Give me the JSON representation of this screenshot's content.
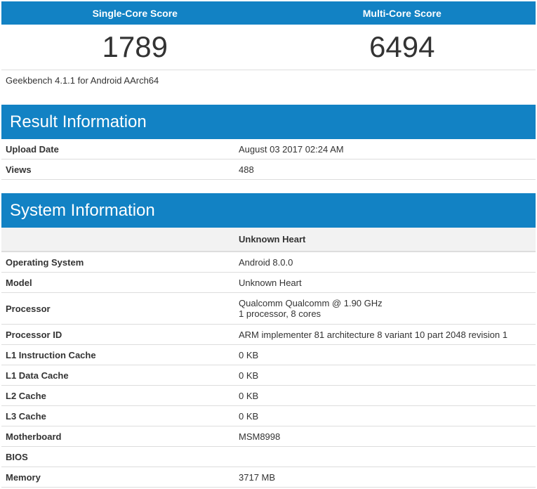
{
  "scores": {
    "single_core_label": "Single-Core Score",
    "multi_core_label": "Multi-Core Score",
    "single_core_value": "1789",
    "multi_core_value": "6494"
  },
  "benchmark_version": "Geekbench 4.1.1 for Android AArch64",
  "result_information": {
    "title": "Result Information",
    "rows": [
      {
        "label": "Upload Date",
        "value": "August 03 2017 02:24 AM"
      },
      {
        "label": "Views",
        "value": "488"
      }
    ]
  },
  "system_information": {
    "title": "System Information",
    "device_name": "Unknown Heart",
    "rows": [
      {
        "label": "Operating System",
        "value": "Android 8.0.0"
      },
      {
        "label": "Model",
        "value": "Unknown Heart"
      },
      {
        "label": "Processor",
        "value": "Qualcomm Qualcomm @ 1.90 GHz",
        "value2": "1 processor, 8 cores"
      },
      {
        "label": "Processor ID",
        "value": "ARM implementer 81 architecture 8 variant 10 part 2048 revision 1"
      },
      {
        "label": "L1 Instruction Cache",
        "value": "0 KB"
      },
      {
        "label": "L1 Data Cache",
        "value": "0 KB"
      },
      {
        "label": "L2 Cache",
        "value": "0 KB"
      },
      {
        "label": "L3 Cache",
        "value": "0 KB"
      },
      {
        "label": "Motherboard",
        "value": "MSM8998"
      },
      {
        "label": "BIOS",
        "value": ""
      },
      {
        "label": "Memory",
        "value": "3717 MB"
      }
    ]
  },
  "colors": {
    "header_blue": "#1282c4",
    "row_border": "#dddddd",
    "subhead_bg": "#f2f2f2"
  }
}
